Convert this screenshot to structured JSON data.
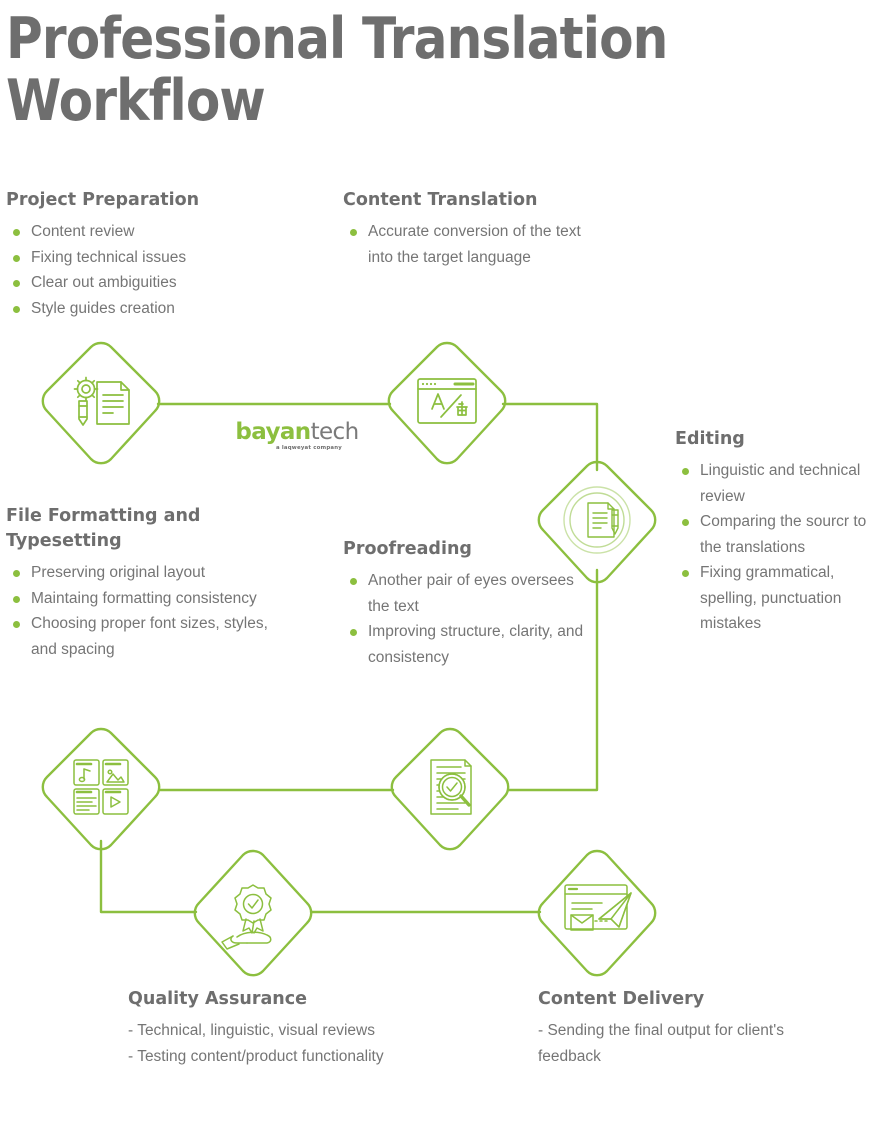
{
  "page": {
    "title": "Professional Translation\nWorkflow",
    "accent_green": "#8cbf3f",
    "heading_gray": "#6e6e6e",
    "body_gray": "#757575",
    "background": "#ffffff"
  },
  "logo": {
    "name_primary": "bayan",
    "name_secondary": "tech",
    "tagline": "a laqweyat company"
  },
  "steps": [
    {
      "id": "project-preparation",
      "heading": "Project Preparation",
      "icon": "gear-document-pencil-icon",
      "bullet_style": "dot",
      "items": [
        "Content review",
        "Fixing technical issues",
        "Clear out ambiguities",
        "Style guides creation"
      ]
    },
    {
      "id": "content-translation",
      "heading": "Content Translation",
      "icon": "translate-browser-window-icon",
      "bullet_style": "dot",
      "items": [
        "Accurate conversion of the text into the target language"
      ]
    },
    {
      "id": "editing",
      "heading": "Editing",
      "icon": "document-pencil-circle-icon",
      "bullet_style": "dot",
      "items": [
        "Linguistic and technical review",
        "Comparing the sourcr to the translations",
        "Fixing grammatical, spelling, punctuation mistakes"
      ]
    },
    {
      "id": "proofreading",
      "heading": "Proofreading",
      "icon": "document-magnifier-check-icon",
      "bullet_style": "dot",
      "items": [
        "Another pair of eyes oversees the text",
        "Improving structure, clarity, and consistency"
      ]
    },
    {
      "id": "file-formatting-and-typesetting",
      "heading": "File Formatting and\nTypesetting",
      "icon": "media-grid-layout-icon",
      "bullet_style": "dot",
      "items": [
        "Preserving original layout",
        "Maintaing formatting consistency",
        "Choosing proper font sizes, styles, and spacing"
      ]
    },
    {
      "id": "quality-assurance",
      "heading": "Quality Assurance",
      "icon": "hand-quality-badge-icon",
      "bullet_style": "dash",
      "items": [
        "- Technical, linguistic, visual reviews",
        "- Testing content/product functionality"
      ]
    },
    {
      "id": "content-delivery",
      "heading": "Content Delivery",
      "icon": "email-paper-plane-icon",
      "bullet_style": "dash",
      "items": [
        "- Sending the final output for client's feedback"
      ]
    }
  ]
}
